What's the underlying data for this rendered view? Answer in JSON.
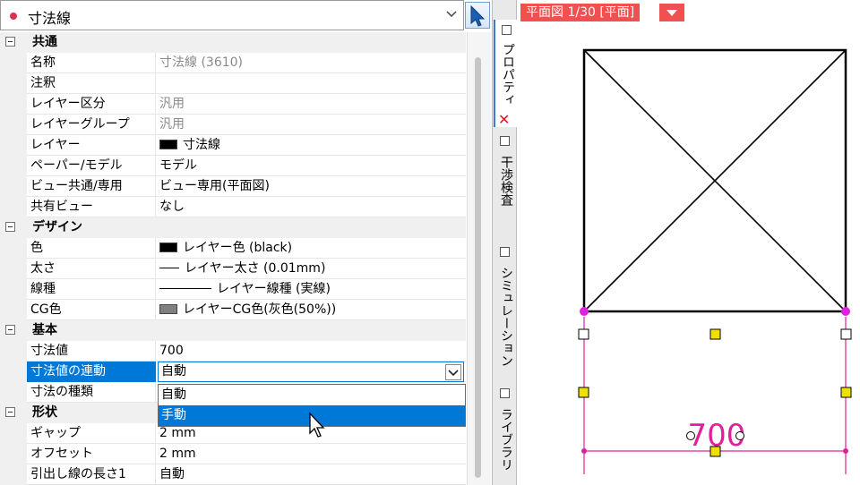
{
  "selector": {
    "label": "寸法線"
  },
  "categories": {
    "common": "共通",
    "design": "デザイン",
    "basic": "基本",
    "shape": "形状"
  },
  "rows": {
    "name": {
      "key": "名称",
      "value": "寸法線 (3610)"
    },
    "note": {
      "key": "注釈",
      "value": ""
    },
    "layer_class": {
      "key": "レイヤー区分",
      "value": "汎用"
    },
    "layer_group": {
      "key": "レイヤーグループ",
      "value": "汎用"
    },
    "layer": {
      "key": "レイヤー",
      "value": "寸法線"
    },
    "paper_model": {
      "key": "ペーパー/モデル",
      "value": "モデル"
    },
    "view_common": {
      "key": "ビュー共通/専用",
      "value": "ビュー専用(平面図)"
    },
    "shared_view": {
      "key": "共有ビュー",
      "value": "なし"
    },
    "color": {
      "key": "色",
      "value": "レイヤー色 (black)"
    },
    "thickness": {
      "key": "太さ",
      "value": "レイヤー太さ (0.01mm)"
    },
    "linetype": {
      "key": "線種",
      "value": "レイヤー線種 (実線)"
    },
    "cg_color": {
      "key": "CG色",
      "value": "レイヤーCG色(灰色(50%))"
    },
    "dim_value": {
      "key": "寸法値",
      "value": "700"
    },
    "dim_link": {
      "key": "寸法値の連動",
      "value": "自動"
    },
    "dim_type": {
      "key": "寸法の種類",
      "value": ""
    },
    "gap": {
      "key": "ギャップ",
      "value": "2 mm"
    },
    "offset": {
      "key": "オフセット",
      "value": "2 mm"
    },
    "leader_len": {
      "key": "引出し線の長さ1",
      "value": "自動"
    }
  },
  "dropdown": {
    "options": [
      "自動",
      "手動"
    ],
    "highlighted": "手動"
  },
  "side_tabs": {
    "properties": "プロパティ",
    "interference": "干渉検査",
    "simulation": "シミュレーション",
    "library": "ライブラリ"
  },
  "view": {
    "tab_label": "平面図 1/30 [平面]",
    "dimension_text": "700"
  },
  "colors": {
    "accent": "#0078d7",
    "view_tab": "#f05050",
    "dimension": "#e0209a",
    "handle": "#f0e000"
  }
}
